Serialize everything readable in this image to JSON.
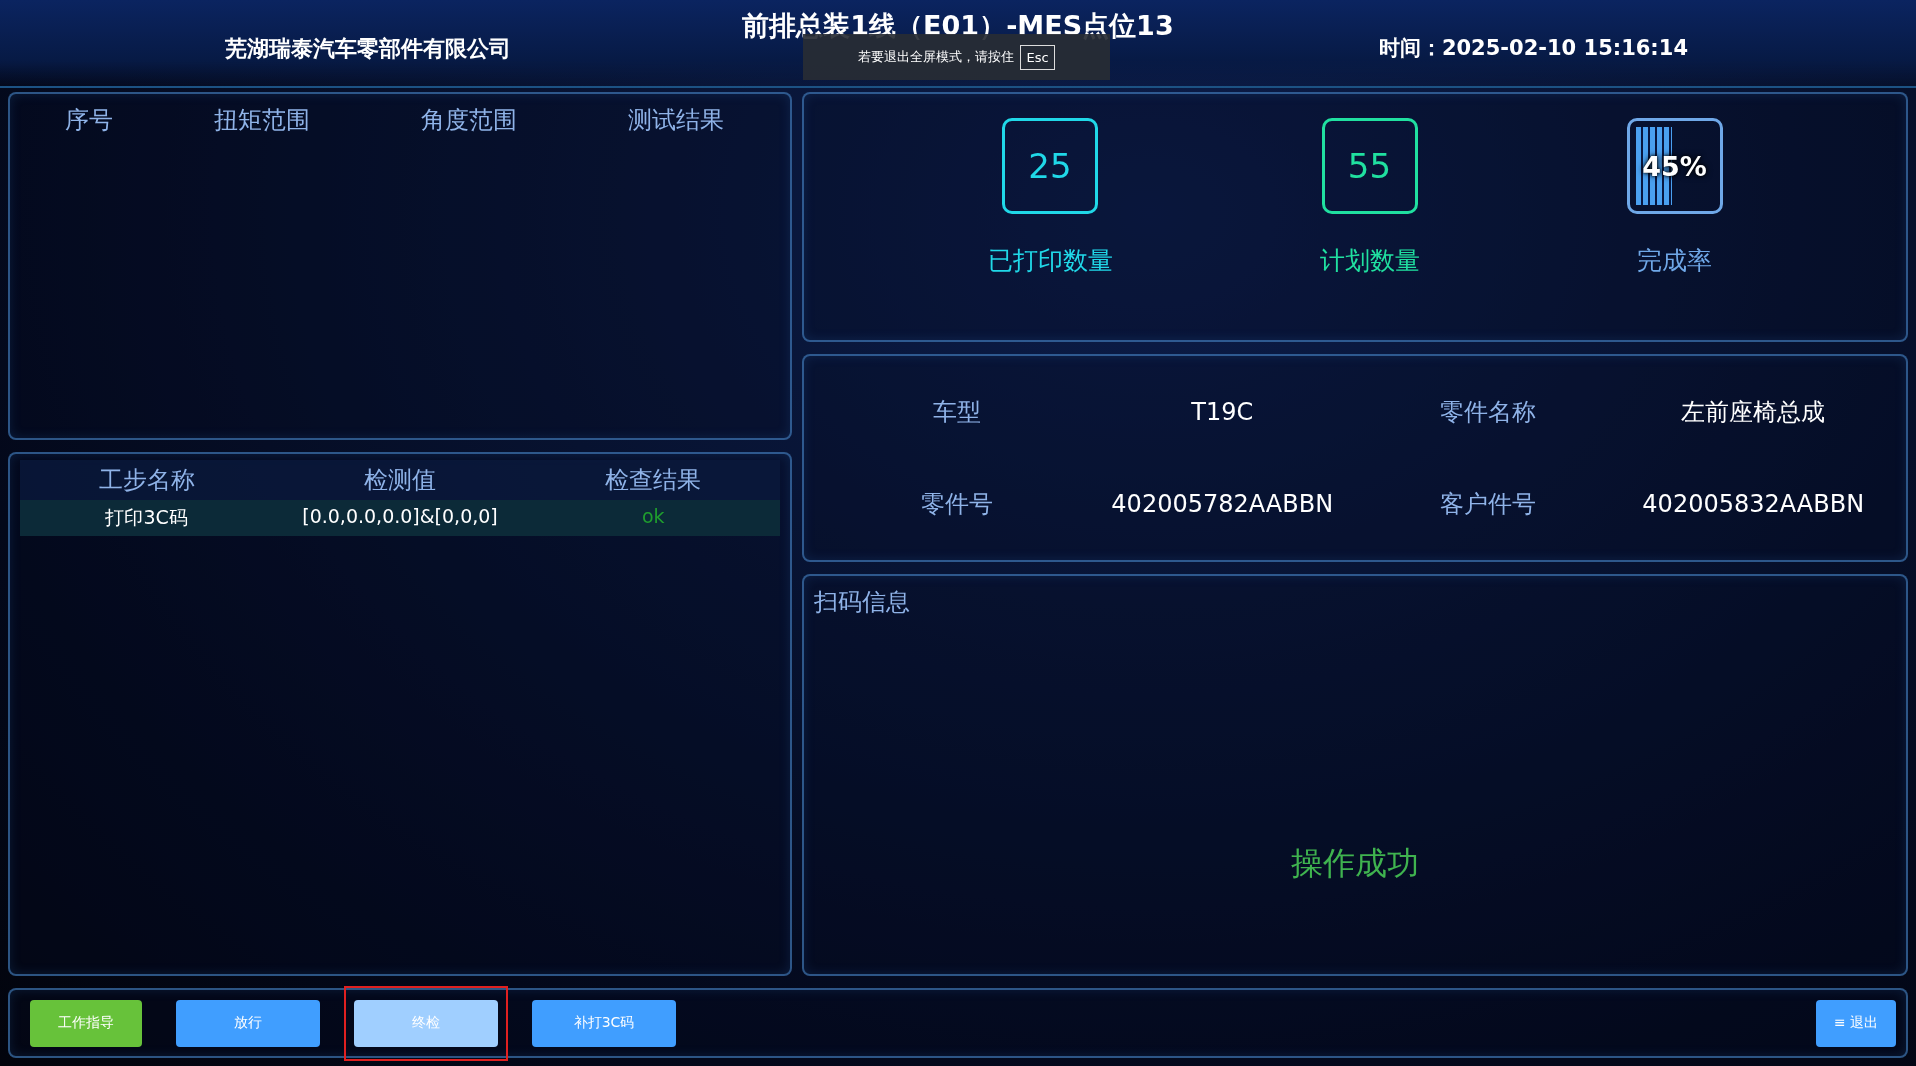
{
  "header": {
    "company": "芜湖瑞泰汽车零部件有限公司",
    "title": "前排总装1线（E01）-MES点位13",
    "time_label": "时间：",
    "time": "2025-02-10 15:16:14"
  },
  "fullscreen_notice": {
    "text": "若要退出全屏模式，请按住",
    "key": "Esc"
  },
  "torque_table": {
    "columns": [
      "序号",
      "扭矩范围",
      "角度范围",
      "测试结果"
    ]
  },
  "step_table": {
    "columns": [
      "工步名称",
      "检测值",
      "检查结果"
    ],
    "rows": [
      {
        "cells": [
          "打印3C码",
          "[0.0,0.0,0.0]&[0,0,0]",
          "ok"
        ],
        "result_ok": true
      }
    ]
  },
  "stats": [
    {
      "kind": "number",
      "value": "25",
      "label": "已打印数量",
      "color": "#20d8e8"
    },
    {
      "kind": "number",
      "value": "55",
      "label": "计划数量",
      "color": "#20e0a0"
    },
    {
      "kind": "percent",
      "value": "45%",
      "label": "完成率",
      "color": "#6fa8e8"
    }
  ],
  "part_info": [
    {
      "label": "车型",
      "value": "T19C"
    },
    {
      "label": "零件名称",
      "value": "左前座椅总成"
    },
    {
      "label": "零件号",
      "value": "402005782AABBN"
    },
    {
      "label": "客户件号",
      "value": "402005832AABBN"
    }
  ],
  "scan": {
    "title": "扫码信息",
    "message": "操作成功"
  },
  "buttons": [
    {
      "label": "工作指导",
      "kind": "green",
      "selected": false
    },
    {
      "label": "放行",
      "kind": "blue",
      "selected": false
    },
    {
      "label": "终检",
      "kind": "blue",
      "selected": true
    },
    {
      "label": "补打3C码",
      "kind": "blue",
      "selected": false
    }
  ],
  "exit_button": {
    "icon": "≡",
    "label": "退出"
  }
}
